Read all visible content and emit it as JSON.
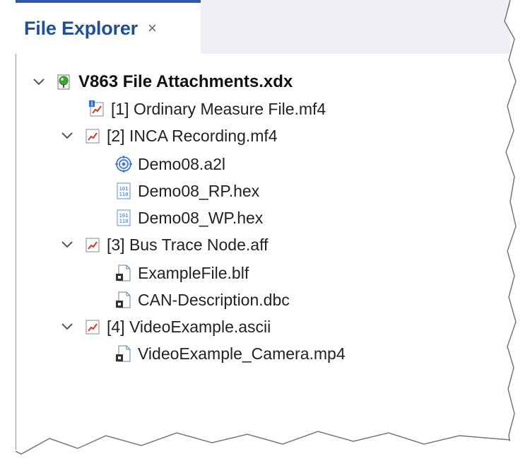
{
  "tab": {
    "title": "File Explorer",
    "close_glyph": "×"
  },
  "tree": {
    "root": {
      "label": "V863 File Attachments.xdx",
      "icon": "green-node-icon"
    },
    "items": [
      {
        "label": "[1] Ordinary Measure File.mf4",
        "icon": "measure-file-info-icon"
      },
      {
        "label": "[2] INCA Recording.mf4",
        "icon": "measure-file-icon"
      },
      {
        "label": "Demo08.a2l",
        "icon": "a2l-target-icon"
      },
      {
        "label": "Demo08_RP.hex",
        "icon": "hex-file-icon"
      },
      {
        "label": "Demo08_WP.hex",
        "icon": "hex-file-icon"
      },
      {
        "label": "[3] Bus Trace Node.aff",
        "icon": "measure-file-icon"
      },
      {
        "label": "ExampleFile.blf",
        "icon": "generic-file-icon"
      },
      {
        "label": "CAN-Description.dbc",
        "icon": "generic-file-icon"
      },
      {
        "label": "[4] VideoExample.ascii",
        "icon": "measure-file-icon"
      },
      {
        "label": "VideoExample_Camera.mp4",
        "icon": "generic-file-icon"
      }
    ]
  },
  "colors": {
    "tab_accent": "#2f5aa8",
    "tab_title": "#1f4f99"
  }
}
